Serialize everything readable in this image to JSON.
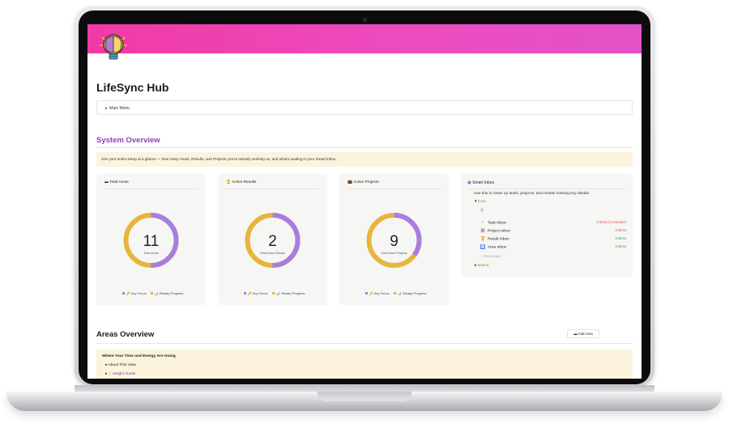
{
  "app": {
    "title": "LifeSync Hub",
    "main_menu": "Main Menu"
  },
  "system_overview": {
    "heading": "System Overview",
    "description": "See your entire setup at a glance — how many Areas, Results, and Projects you're actively working on, and what's waiting in your Smart Inbox."
  },
  "cards": [
    {
      "icon": "folder-icon",
      "title": "Total Areas",
      "value": "11",
      "caption": "Total Areas",
      "fraction": 0.5
    },
    {
      "icon": "trophy-icon",
      "title": "Active Results",
      "value": "2",
      "caption": "Total Active Results",
      "fraction": 0.5
    },
    {
      "icon": "briefcase-icon",
      "title": "Active Projects",
      "value": "9",
      "caption": "Total Active Projects",
      "fraction": 0.35
    }
  ],
  "legend": {
    "key_focus": "Key Focus",
    "steady_progress": "Steady Progress",
    "key_focus_color": "#a77ee0",
    "steady_progress_color": "#e8b53b"
  },
  "smart_inbox": {
    "title": "Smart Inbox",
    "description": "Use this to clean up tasks, projects, and results missing key details.",
    "core_label": "Core",
    "list_icon": "☰",
    "rows": [
      {
        "icon": "check-icon",
        "label": "Task Inbox",
        "count": "6 Items (3 Overdue)",
        "count_color": "#e14b4b"
      },
      {
        "icon": "doc-icon",
        "label": "Project Inbox",
        "count": "2 Items",
        "count_color": "#e14b4b"
      },
      {
        "icon": "trophy-icon",
        "label": "Result Inbox",
        "count": "0 Items",
        "count_color": "#2f9e55"
      },
      {
        "icon": "grid-icon",
        "label": "Area Inbox",
        "count": "0 Items",
        "count_color": "#2f9e55"
      }
    ],
    "new_page": "New page",
    "bonus_label": "Bonus"
  },
  "areas_overview": {
    "heading": "Areas Overview",
    "add_button": "Add Area",
    "callout_title": "Where Your Time and Energy Are Going",
    "about": "About This View",
    "insight": "Insight Guide"
  },
  "colors": {
    "accent_purple": "#8d3fb8",
    "cover_pink": "#f03aa6",
    "callout_bg": "#fbf3dc"
  }
}
